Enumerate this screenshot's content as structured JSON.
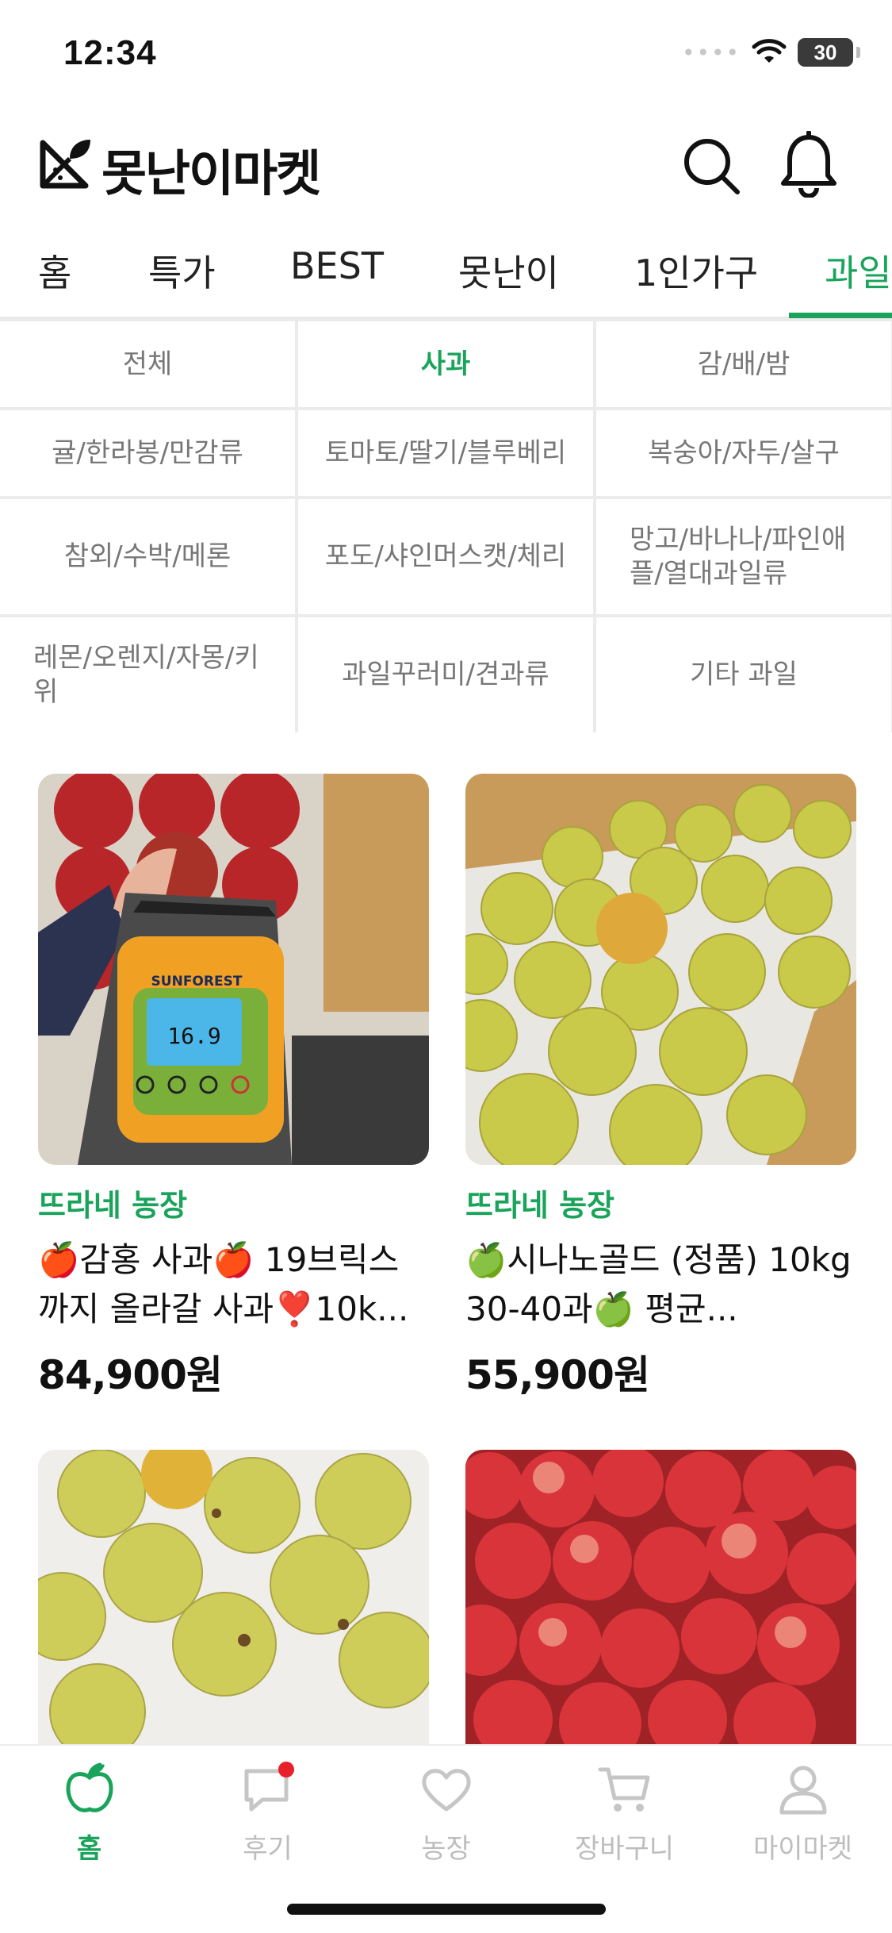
{
  "status": {
    "time": "12:34",
    "battery": "30"
  },
  "header": {
    "title": "못난이마켓",
    "logo": "logo-icon",
    "search": "search-icon",
    "notification": "bell-icon"
  },
  "tabs": [
    {
      "label": "홈",
      "active": false
    },
    {
      "label": "특가",
      "active": false
    },
    {
      "label": "BEST",
      "active": false
    },
    {
      "label": "못난이",
      "active": false
    },
    {
      "label": "1인가구",
      "active": false
    },
    {
      "label": "과일",
      "active": true
    }
  ],
  "categories": [
    {
      "label": "전체"
    },
    {
      "label": "사과",
      "active": true
    },
    {
      "label": "감/배/밤"
    },
    {
      "label": "귤/한라봉/만감류"
    },
    {
      "label": "토마토/딸기/블루베리"
    },
    {
      "label": "복숭아/자두/살구"
    },
    {
      "label": "참외/수박/메론"
    },
    {
      "label": "포도/샤인머스캣/체리"
    },
    {
      "label": "망고/바나나/파인애플/열대과일류"
    },
    {
      "label": "레몬/오렌지/자몽/키위"
    },
    {
      "label": "과일꾸러미/견과류"
    },
    {
      "label": "기타 과일"
    }
  ],
  "products": [
    {
      "farm": "뜨라네 농장",
      "name": "🍎감홍 사과🍎 19브릭스까지 올라갈 사과❣️10k...",
      "price": "84,900원",
      "meter_brand": "SUNFOREST",
      "meter_reading": "16.9"
    },
    {
      "farm": "뜨라네 농장",
      "name": "🍏시나노골드 (정품) 10kg 30-40과🍏 평균...",
      "price": "55,900원"
    },
    {
      "farm": "",
      "name": "",
      "price": ""
    },
    {
      "farm": "",
      "name": "",
      "price": ""
    }
  ],
  "bottom_nav": [
    {
      "label": "홈",
      "icon": "apple-icon",
      "active": true
    },
    {
      "label": "후기",
      "icon": "chat-bubble-icon",
      "badge": true
    },
    {
      "label": "농장",
      "icon": "heart-icon"
    },
    {
      "label": "장바구니",
      "icon": "cart-icon"
    },
    {
      "label": "마이마켓",
      "icon": "user-icon"
    }
  ],
  "colors": {
    "accent": "#1aa35a",
    "badge": "#e8202a",
    "inactive": "#bdbdbd"
  }
}
